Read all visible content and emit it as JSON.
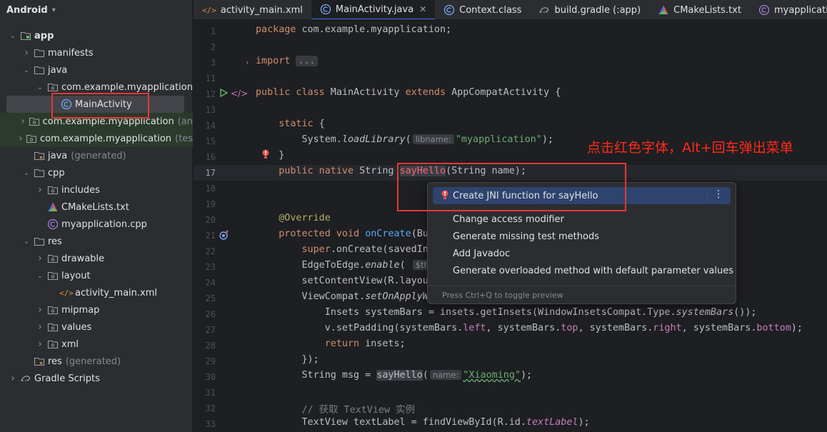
{
  "project": {
    "view_label": "Android",
    "tree": [
      {
        "label": "app",
        "type": "module",
        "indent": 0,
        "arrow": "down",
        "bold": true
      },
      {
        "label": "manifests",
        "type": "folder",
        "indent": 1,
        "arrow": "right"
      },
      {
        "label": "java",
        "type": "folder",
        "indent": 1,
        "arrow": "down"
      },
      {
        "label": "com.example.myapplication",
        "type": "package",
        "indent": 2,
        "arrow": "down"
      },
      {
        "label": "MainActivity",
        "type": "class",
        "indent": 3,
        "arrow": "",
        "selected": true
      },
      {
        "label": "com.example.myapplication",
        "suffix": "(an",
        "type": "package",
        "indent": 2,
        "arrow": "right",
        "green": true
      },
      {
        "label": "com.example.myapplication",
        "suffix": "(tes",
        "type": "package",
        "indent": 2,
        "arrow": "right",
        "green": true
      },
      {
        "label": "java",
        "suffix": "(generated)",
        "type": "folder-gen",
        "indent": 1,
        "arrow": ""
      },
      {
        "label": "cpp",
        "type": "folder",
        "indent": 1,
        "arrow": "down"
      },
      {
        "label": "includes",
        "type": "package",
        "indent": 2,
        "arrow": "right"
      },
      {
        "label": "CMakeLists.txt",
        "type": "cmake",
        "indent": 2,
        "arrow": ""
      },
      {
        "label": "myapplication.cpp",
        "type": "cpp",
        "indent": 2,
        "arrow": ""
      },
      {
        "label": "res",
        "type": "folder",
        "indent": 1,
        "arrow": "down"
      },
      {
        "label": "drawable",
        "type": "package",
        "indent": 2,
        "arrow": "right"
      },
      {
        "label": "layout",
        "type": "package",
        "indent": 2,
        "arrow": "down"
      },
      {
        "label": "activity_main.xml",
        "type": "xml",
        "indent": 3,
        "arrow": ""
      },
      {
        "label": "mipmap",
        "type": "package",
        "indent": 2,
        "arrow": "right"
      },
      {
        "label": "values",
        "type": "package",
        "indent": 2,
        "arrow": "right"
      },
      {
        "label": "xml",
        "type": "package",
        "indent": 2,
        "arrow": "right"
      },
      {
        "label": "res",
        "suffix": "(generated)",
        "type": "folder-gen",
        "indent": 1,
        "arrow": ""
      },
      {
        "label": "Gradle Scripts",
        "type": "gradle",
        "indent": 0,
        "arrow": "right"
      }
    ]
  },
  "tabs": [
    {
      "label": "activity_main.xml",
      "icon": "xml-icon"
    },
    {
      "label": "MainActivity.java",
      "icon": "class-icon",
      "active": true,
      "closable": true
    },
    {
      "label": "Context.class",
      "icon": "class-icon"
    },
    {
      "label": "build.gradle (:app)",
      "icon": "gradle-icon"
    },
    {
      "label": "CMakeLists.txt",
      "icon": "cmake-icon"
    },
    {
      "label": "myapplication.cpp",
      "icon": "cpp-icon"
    }
  ],
  "editor": {
    "current_line": "17",
    "lines": [
      {
        "n": "1",
        "html": "<span class=\"kw\">package</span> com.example.myapplication;"
      },
      {
        "n": "2",
        "html": ""
      },
      {
        "n": "3",
        "html": "<span class=\"kw\">import</span> <span class=\"fold\">...</span>"
      },
      {
        "n": "11",
        "html": ""
      },
      {
        "n": "12",
        "html": "<span class=\"kw\">public class</span> MainActivity <span class=\"kw\">extends</span> AppCompatActivity {"
      },
      {
        "n": "13",
        "html": ""
      },
      {
        "n": "14",
        "html": "    <span class=\"kw\">static</span> {"
      },
      {
        "n": "15",
        "html": "        System.<span class=\"st\">loadLibrary</span>(<span class=\"hint\">libname:</span><span class=\"str\">\"myapplication\"</span>);"
      },
      {
        "n": "16",
        "html": "    }"
      },
      {
        "n": "17",
        "html": "    <span class=\"kw\">public native</span> String <span class=\"usage\" style=\"color:#fa6675\">sayHello</span>(String name);"
      },
      {
        "n": "18",
        "html": ""
      },
      {
        "n": "19",
        "html": ""
      },
      {
        "n": "20",
        "html": "    <span class=\"ann\">@Override</span>"
      },
      {
        "n": "21",
        "html": "    <span class=\"kw\">protected void</span> <span class=\"fn\">onCreate</span>(Bu"
      },
      {
        "n": "22",
        "html": "        <span class=\"kw\">super</span>.onCreate(savedIn"
      },
      {
        "n": "23",
        "html": "        EdgeToEdge.<span class=\"st\">enable</span>( <span class=\"hint\">$this</span>"
      },
      {
        "n": "24",
        "html": "        setContentView(R.layou"
      },
      {
        "n": "25",
        "html": "        ViewCompat.<span class=\"st\">setOnApplyW</span>                                     s) -> {"
      },
      {
        "n": "26",
        "html": "            Insets systemBars = insets.getInsets(WindowInsetsCompat.Type.<span class=\"st\">systemBars</span>());"
      },
      {
        "n": "27",
        "html": "            v.setPadding(systemBars.<span class=\"fld\">left</span>, systemBars.<span class=\"fld\">top</span>, systemBars.<span class=\"fld\">right</span>, systemBars.<span class=\"fld\">bottom</span>);"
      },
      {
        "n": "28",
        "html": "            <span class=\"kw\">return</span> insets;"
      },
      {
        "n": "29",
        "html": "        });"
      },
      {
        "n": "30",
        "html": "        String msg = <span class=\"usage\">sayHello</span>(<span class=\"hint\">name:</span><span class=\"str wavy\">\"Xiaoming\"</span>);"
      },
      {
        "n": "31",
        "html": ""
      },
      {
        "n": "32",
        "html": "        <span class=\"cmt\">// 获取 TextView 实例</span>"
      },
      {
        "n": "33",
        "html": "        TextView textLabel = findViewById(R.id.<span class=\"fldi\">textLabel</span>);"
      }
    ]
  },
  "popup": {
    "items": [
      {
        "label": "Create JNI function for sayHello",
        "selected": true
      },
      {
        "label": "Change access modifier"
      },
      {
        "label": "Generate missing test methods"
      },
      {
        "label": "Add Javadoc"
      },
      {
        "label": "Generate overloaded method with default parameter values"
      }
    ],
    "more_label": "⋮",
    "footer": "Press Ctrl+Q to toggle preview"
  },
  "annotation": "点击红色字体，Alt+回车弹出菜单",
  "colors": {
    "accent": "#3574f0",
    "annotation_red": "#ff2a1a",
    "popup_selected": "#2e436e"
  }
}
